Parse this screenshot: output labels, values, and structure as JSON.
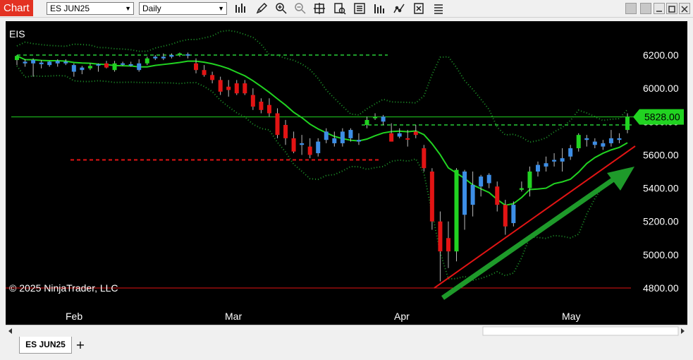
{
  "window": {
    "title": "Chart"
  },
  "toolbar": {
    "instrument": "ES JUN25",
    "interval": "Daily",
    "icons": [
      "bar-type-icon",
      "pencil-draw-icon",
      "zoom-in-icon",
      "zoom-out-icon",
      "crosshair-icon",
      "strategy-icon",
      "data-box-icon",
      "indicators-icon",
      "strategies-chart-icon",
      "properties-icon",
      "templates-icon"
    ]
  },
  "chart": {
    "series_label": "EIS",
    "copyright": "© 2025 NinjaTrader, LLC",
    "price_labels": [
      "6200.00",
      "6000.00",
      "5800.00",
      "5600.00",
      "5400.00",
      "5200.00",
      "5000.00",
      "4800.00"
    ],
    "date_labels": [
      "Feb",
      "Mar",
      "Apr",
      "May"
    ],
    "current_price": "5828.00",
    "colors": {
      "up": "#21d321",
      "down": "#e21414",
      "blue": "#3d8ee6",
      "sma": "#21d321",
      "bollinger": "#1e9a2a",
      "red_line": "#e21414"
    }
  },
  "chart_data": {
    "type": "candlestick",
    "instrument": "ES JUN25",
    "interval": "Daily",
    "y_ticks": [
      6200,
      6000,
      5800,
      5600,
      5400,
      5200,
      5000,
      4800
    ],
    "x_ticks": [
      "Feb",
      "Mar",
      "Apr",
      "May"
    ],
    "last_price": 5828.0,
    "candles": [
      {
        "o": 6170,
        "h": 6200,
        "l": 6140,
        "c": 6195,
        "col": "up"
      },
      {
        "o": 6160,
        "h": 6175,
        "l": 6130,
        "c": 6150,
        "col": "blue"
      },
      {
        "o": 6150,
        "h": 6180,
        "l": 6070,
        "c": 6170,
        "col": "blue"
      },
      {
        "o": 6145,
        "h": 6170,
        "l": 6120,
        "c": 6155,
        "col": "blue"
      },
      {
        "o": 6140,
        "h": 6165,
        "l": 6130,
        "c": 6160,
        "col": "blue"
      },
      {
        "o": 6150,
        "h": 6175,
        "l": 6130,
        "c": 6165,
        "col": "blue"
      },
      {
        "o": 6160,
        "h": 6175,
        "l": 6140,
        "c": 6150,
        "col": "blue"
      },
      {
        "o": 6140,
        "h": 6150,
        "l": 6070,
        "c": 6100,
        "col": "blue"
      },
      {
        "o": 6110,
        "h": 6135,
        "l": 6085,
        "c": 6125,
        "col": "blue"
      },
      {
        "o": 6120,
        "h": 6150,
        "l": 6110,
        "c": 6135,
        "col": "up"
      },
      {
        "o": 6140,
        "h": 6150,
        "l": 6100,
        "c": 6145,
        "col": "blue"
      },
      {
        "o": 6150,
        "h": 6165,
        "l": 6120,
        "c": 6125,
        "col": "down"
      },
      {
        "o": 6150,
        "h": 6165,
        "l": 6100,
        "c": 6110,
        "col": "up"
      },
      {
        "o": 6150,
        "h": 6160,
        "l": 6135,
        "c": 6145,
        "col": "blue"
      },
      {
        "o": 6140,
        "h": 6160,
        "l": 6130,
        "c": 6145,
        "col": "blue"
      },
      {
        "o": 6150,
        "h": 6175,
        "l": 6100,
        "c": 6110,
        "col": "blue"
      },
      {
        "o": 6180,
        "h": 6190,
        "l": 6140,
        "c": 6150,
        "col": "up"
      },
      {
        "o": 6180,
        "h": 6200,
        "l": 6170,
        "c": 6190,
        "col": "blue"
      },
      {
        "o": 6190,
        "h": 6210,
        "l": 6170,
        "c": 6180,
        "col": "blue"
      },
      {
        "o": 6200,
        "h": 6210,
        "l": 6180,
        "c": 6190,
        "col": "blue"
      },
      {
        "o": 6200,
        "h": 6215,
        "l": 6190,
        "c": 6210,
        "col": "up"
      },
      {
        "o": 6200,
        "h": 6215,
        "l": 6180,
        "c": 6205,
        "col": "blue"
      },
      {
        "o": 6150,
        "h": 6180,
        "l": 6090,
        "c": 6110,
        "col": "down"
      },
      {
        "o": 6110,
        "h": 6140,
        "l": 6070,
        "c": 6080,
        "col": "down"
      },
      {
        "o": 6080,
        "h": 6100,
        "l": 6030,
        "c": 6050,
        "col": "down"
      },
      {
        "o": 6050,
        "h": 6070,
        "l": 5960,
        "c": 5980,
        "col": "down"
      },
      {
        "o": 6010,
        "h": 6050,
        "l": 5950,
        "c": 5990,
        "col": "down"
      },
      {
        "o": 6030,
        "h": 6050,
        "l": 5960,
        "c": 5970,
        "col": "down"
      },
      {
        "o": 6030,
        "h": 6050,
        "l": 5960,
        "c": 5970,
        "col": "down"
      },
      {
        "o": 5960,
        "h": 6000,
        "l": 5870,
        "c": 5890,
        "col": "down"
      },
      {
        "o": 5920,
        "h": 5940,
        "l": 5850,
        "c": 5870,
        "col": "down"
      },
      {
        "o": 5900,
        "h": 5940,
        "l": 5830,
        "c": 5850,
        "col": "down"
      },
      {
        "o": 5850,
        "h": 5880,
        "l": 5700,
        "c": 5720,
        "col": "down"
      },
      {
        "o": 5780,
        "h": 5810,
        "l": 5660,
        "c": 5700,
        "col": "down"
      },
      {
        "o": 5700,
        "h": 5740,
        "l": 5610,
        "c": 5620,
        "col": "down"
      },
      {
        "o": 5670,
        "h": 5720,
        "l": 5600,
        "c": 5660,
        "col": "blue"
      },
      {
        "o": 5650,
        "h": 5700,
        "l": 5580,
        "c": 5600,
        "col": "down"
      },
      {
        "o": 5610,
        "h": 5700,
        "l": 5590,
        "c": 5680,
        "col": "blue"
      },
      {
        "o": 5690,
        "h": 5760,
        "l": 5670,
        "c": 5740,
        "col": "blue"
      },
      {
        "o": 5700,
        "h": 5740,
        "l": 5650,
        "c": 5670,
        "col": "blue"
      },
      {
        "o": 5670,
        "h": 5760,
        "l": 5650,
        "c": 5740,
        "col": "blue"
      },
      {
        "o": 5700,
        "h": 5760,
        "l": 5680,
        "c": 5750,
        "col": "blue"
      },
      {
        "o": 5690,
        "h": 5730,
        "l": 5660,
        "c": 5680,
        "col": "blue"
      },
      {
        "o": 5780,
        "h": 5830,
        "l": 5760,
        "c": 5810,
        "col": "up"
      },
      {
        "o": 5830,
        "h": 5850,
        "l": 5810,
        "c": 5820,
        "col": "up"
      },
      {
        "o": 5800,
        "h": 5840,
        "l": 5780,
        "c": 5830,
        "col": "blue"
      },
      {
        "o": 5730,
        "h": 5790,
        "l": 5680,
        "c": 5680,
        "col": "down"
      },
      {
        "o": 5730,
        "h": 5760,
        "l": 5700,
        "c": 5710,
        "col": "blue"
      },
      {
        "o": 5700,
        "h": 5750,
        "l": 5650,
        "c": 5700,
        "col": "down"
      },
      {
        "o": 5740,
        "h": 5780,
        "l": 5700,
        "c": 5720,
        "col": "down"
      },
      {
        "o": 5640,
        "h": 5660,
        "l": 5500,
        "c": 5520,
        "col": "down"
      },
      {
        "o": 5500,
        "h": 5520,
        "l": 5150,
        "c": 5200,
        "col": "down"
      },
      {
        "o": 5200,
        "h": 5260,
        "l": 4840,
        "c": 5020,
        "col": "down"
      },
      {
        "o": 5100,
        "h": 5200,
        "l": 4920,
        "c": 5020,
        "col": "down"
      },
      {
        "o": 5020,
        "h": 5520,
        "l": 4960,
        "c": 5510,
        "col": "up"
      },
      {
        "o": 5240,
        "h": 5510,
        "l": 5150,
        "c": 5500,
        "col": "blue"
      },
      {
        "o": 5420,
        "h": 5500,
        "l": 5230,
        "c": 5300,
        "col": "blue"
      },
      {
        "o": 5410,
        "h": 5480,
        "l": 5350,
        "c": 5470,
        "col": "blue"
      },
      {
        "o": 5430,
        "h": 5490,
        "l": 5400,
        "c": 5480,
        "col": "blue"
      },
      {
        "o": 5410,
        "h": 5440,
        "l": 5260,
        "c": 5300,
        "col": "down"
      },
      {
        "o": 5300,
        "h": 5330,
        "l": 5120,
        "c": 5170,
        "col": "down"
      },
      {
        "o": 5190,
        "h": 5320,
        "l": 5170,
        "c": 5300,
        "col": "blue"
      },
      {
        "o": 5400,
        "h": 5440,
        "l": 5380,
        "c": 5390,
        "col": "up"
      },
      {
        "o": 5400,
        "h": 5530,
        "l": 5350,
        "c": 5500,
        "col": "up"
      },
      {
        "o": 5500,
        "h": 5560,
        "l": 5470,
        "c": 5540,
        "col": "blue"
      },
      {
        "o": 5530,
        "h": 5590,
        "l": 5500,
        "c": 5550,
        "col": "blue"
      },
      {
        "o": 5560,
        "h": 5610,
        "l": 5530,
        "c": 5570,
        "col": "blue"
      },
      {
        "o": 5560,
        "h": 5640,
        "l": 5500,
        "c": 5580,
        "col": "blue"
      },
      {
        "o": 5590,
        "h": 5660,
        "l": 5570,
        "c": 5640,
        "col": "blue"
      },
      {
        "o": 5640,
        "h": 5730,
        "l": 5620,
        "c": 5720,
        "col": "up"
      },
      {
        "o": 5700,
        "h": 5720,
        "l": 5650,
        "c": 5690,
        "col": "blue"
      },
      {
        "o": 5680,
        "h": 5700,
        "l": 5640,
        "c": 5660,
        "col": "blue"
      },
      {
        "o": 5670,
        "h": 5690,
        "l": 5630,
        "c": 5650,
        "col": "blue"
      },
      {
        "o": 5670,
        "h": 5750,
        "l": 5650,
        "c": 5700,
        "col": "blue"
      },
      {
        "o": 5700,
        "h": 5730,
        "l": 5670,
        "c": 5690,
        "col": "blue"
      },
      {
        "o": 5750,
        "h": 5850,
        "l": 5730,
        "c": 5830,
        "col": "up"
      }
    ],
    "levels": [
      {
        "name": "upper-dashed-green",
        "value": 6200
      },
      {
        "name": "mid-dashed-green",
        "value": 5780
      },
      {
        "name": "dashed-red",
        "value": 5570
      },
      {
        "name": "solid-red-bottom",
        "value": 4800
      },
      {
        "name": "solid-green-current",
        "value": 5828
      }
    ]
  }
}
